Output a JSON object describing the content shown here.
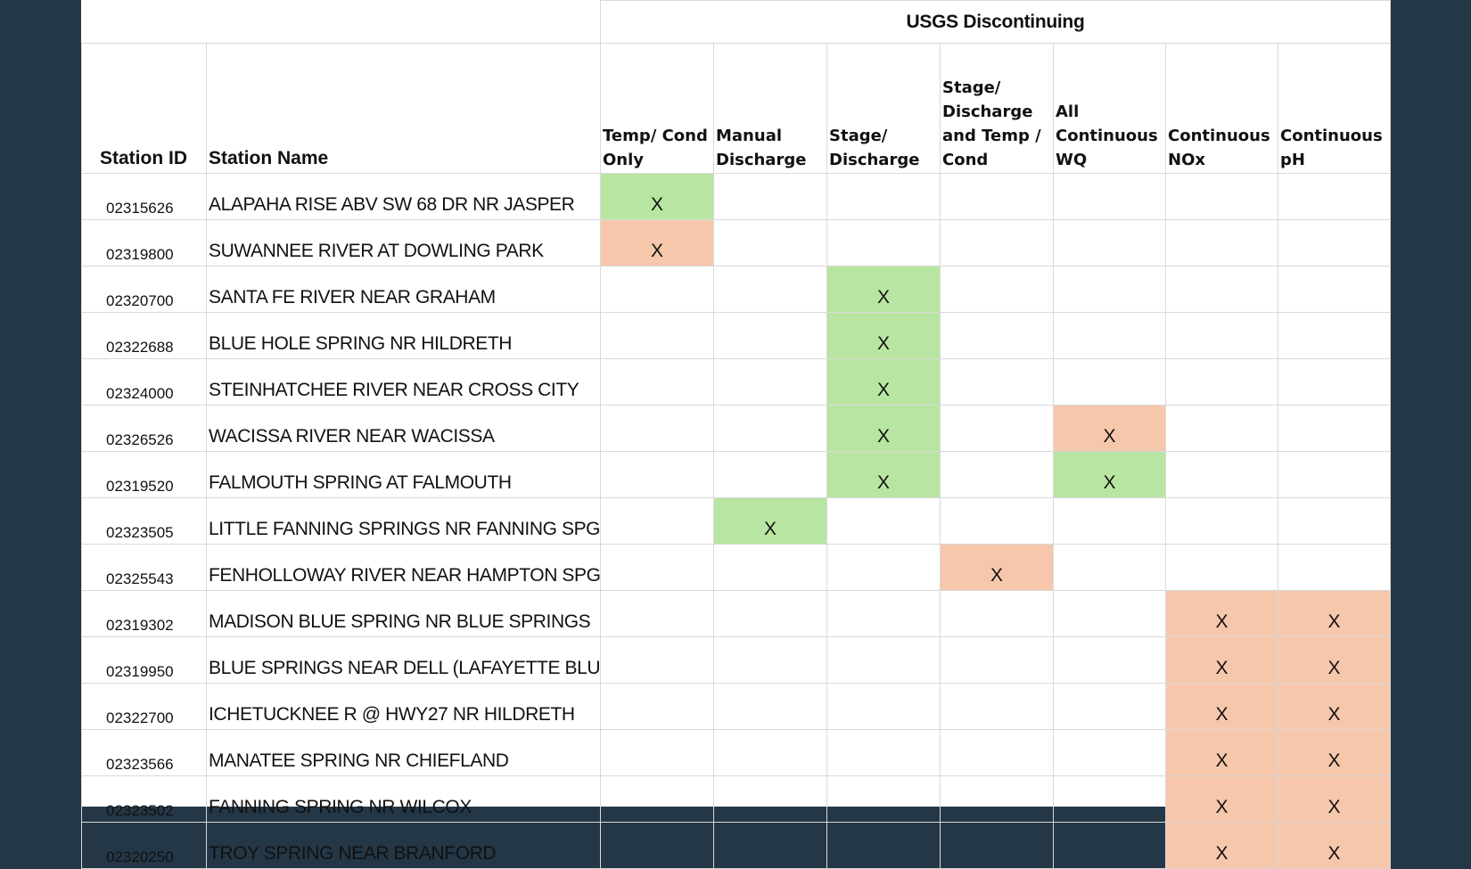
{
  "header": {
    "super_title": "USGS Discontinuing",
    "station_id": "Station ID",
    "station_name": "Station Name",
    "columns": [
      "Temp/ Cond Only",
      "Manual Discharge",
      "Stage/ Discharge",
      "Stage/ Discharge and Temp / Cond",
      "All Continuous WQ",
      "Continuous NOx",
      "Continuous pH"
    ]
  },
  "mark_symbol": "X",
  "colors": {
    "green": "#b9e5a2",
    "orange": "#f6c7ab",
    "background": "#243746"
  },
  "rows": [
    {
      "id": "02315626",
      "name": "ALAPAHA RISE ABV SW 68 DR NR JASPER",
      "cells": [
        "green",
        "",
        "",
        "",
        "",
        "",
        ""
      ]
    },
    {
      "id": "02319800",
      "name": "SUWANNEE RIVER AT DOWLING PARK",
      "cells": [
        "orange",
        "",
        "",
        "",
        "",
        "",
        ""
      ]
    },
    {
      "id": "02320700",
      "name": "SANTA FE RIVER NEAR GRAHAM",
      "cells": [
        "",
        "",
        "green",
        "",
        "",
        "",
        ""
      ]
    },
    {
      "id": "02322688",
      "name": "BLUE HOLE SPRING NR HILDRETH",
      "cells": [
        "",
        "",
        "green",
        "",
        "",
        "",
        ""
      ]
    },
    {
      "id": "02324000",
      "name": "STEINHATCHEE RIVER NEAR CROSS CITY",
      "cells": [
        "",
        "",
        "green",
        "",
        "",
        "",
        ""
      ]
    },
    {
      "id": "02326526",
      "name": "WACISSA RIVER NEAR WACISSA",
      "cells": [
        "",
        "",
        "green",
        "",
        "orange",
        "",
        ""
      ]
    },
    {
      "id": "02319520",
      "name": "FALMOUTH SPRING AT FALMOUTH",
      "cells": [
        "",
        "",
        "green",
        "",
        "green",
        "",
        ""
      ]
    },
    {
      "id": "02323505",
      "name": "LITTLE FANNING SPRINGS NR FANNING SPGS",
      "cells": [
        "",
        "green",
        "",
        "",
        "",
        "",
        ""
      ]
    },
    {
      "id": "02325543",
      "name": "FENHOLLOWAY RIVER NEAR HAMPTON SPGS",
      "cells": [
        "",
        "",
        "",
        "orange",
        "",
        "",
        ""
      ]
    },
    {
      "id": "02319302",
      "name": "MADISON BLUE SPRING NR BLUE SPRINGS",
      "cells": [
        "",
        "",
        "",
        "",
        "",
        "orange",
        "orange"
      ]
    },
    {
      "id": "02319950",
      "name": "BLUE SPRINGS NEAR DELL (LAFAYETTE BLUE)",
      "cells": [
        "",
        "",
        "",
        "",
        "",
        "orange",
        "orange"
      ]
    },
    {
      "id": "02322700",
      "name": "ICHETUCKNEE R @ HWY27 NR HILDRETH",
      "cells": [
        "",
        "",
        "",
        "",
        "",
        "orange",
        "orange"
      ]
    },
    {
      "id": "02323566",
      "name": "MANATEE SPRING NR CHIEFLAND",
      "cells": [
        "",
        "",
        "",
        "",
        "",
        "orange",
        "orange"
      ]
    },
    {
      "id": "02323502",
      "name": "FANNING SPRING NR WILCOX",
      "cells": [
        "",
        "",
        "",
        "",
        "",
        "orange",
        "orange"
      ]
    },
    {
      "id": "02320250",
      "name": "TROY SPRING NEAR BRANFORD",
      "cells": [
        "",
        "",
        "",
        "",
        "",
        "orange",
        "orange"
      ]
    }
  ]
}
